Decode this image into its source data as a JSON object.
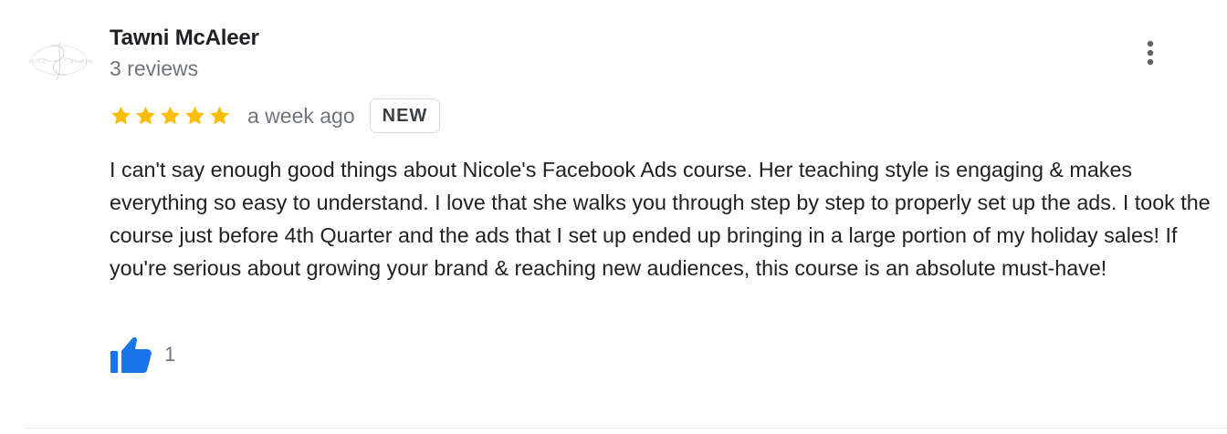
{
  "review": {
    "reviewer_name": "Tawni McAleer",
    "review_count": "3 reviews",
    "rating": 5,
    "max_rating": 5,
    "date": "a week ago",
    "badge": "NEW",
    "text": "I can't say enough good things about Nicole's Facebook Ads course. Her teaching style is engaging & makes everything so easy to understand. I love that she walks you through step by step to properly set up the ads. I took the course just before 4th Quarter and the ads that I set up ended up bringing in a large portion of my holiday sales! If you're serious about growing your brand & reaching new audiences, this course is an absolute must-have!",
    "likes": "1"
  },
  "icons": {
    "avatar": "brand-logo-avatar",
    "more": "more-vert-icon",
    "star": "star-icon",
    "like": "thumbs-up-icon"
  },
  "colors": {
    "star": "#fbbc04",
    "like": "#1a73e8",
    "secondary_text": "#70757a",
    "primary_text": "#202124",
    "divider": "#e8eaed"
  }
}
